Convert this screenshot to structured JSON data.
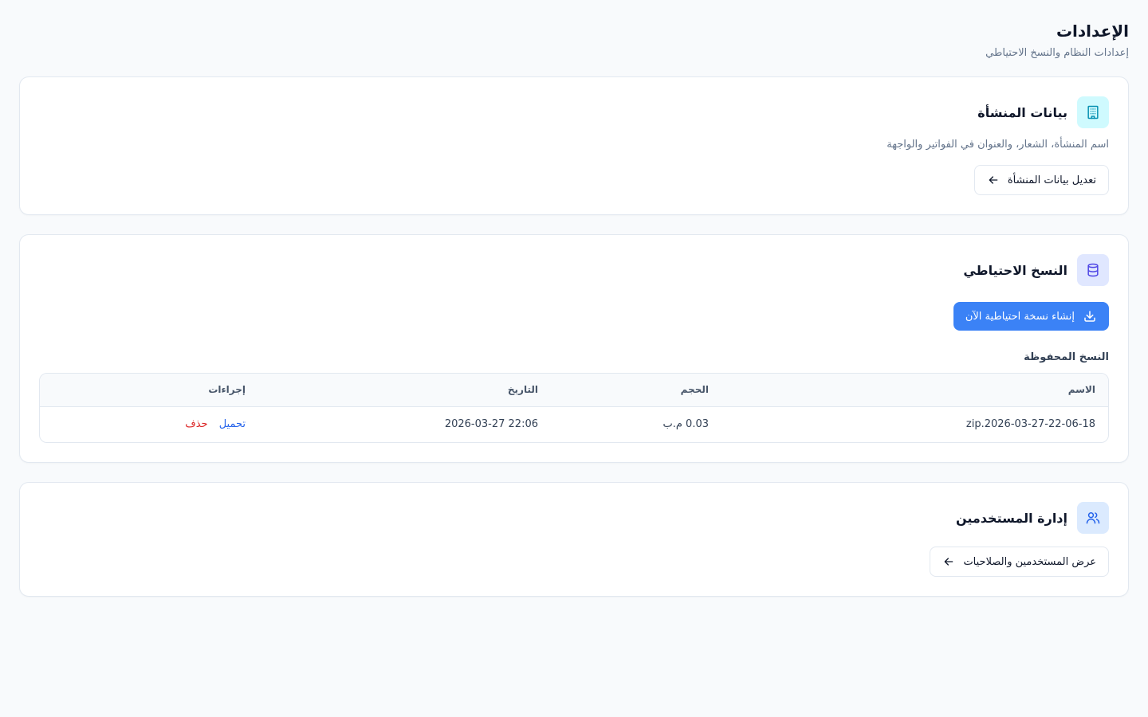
{
  "page": {
    "title": "الإعدادات",
    "subtitle": "إعدادات النظام والنسخ الاحتياطي"
  },
  "organization": {
    "title": "بيانات المنشأة",
    "description": "اسم المنشأة، الشعار، والعنوان في الفواتير والواجهة",
    "edit_button": "تعديل بيانات المنشأة",
    "icon": "building-icon",
    "icon_bg": "#cffafe",
    "icon_color": "#0891b2"
  },
  "backup": {
    "title": "النسخ الاحتياطي",
    "create_button": "إنشاء نسخة احتياطية الآن",
    "saved_label": "النسخ المحفوظة",
    "icon": "database-icon",
    "icon_bg": "#e0e7ff",
    "icon_color": "#4f46e5",
    "button_color": "#3b82f6",
    "table": {
      "columns": [
        "الاسم",
        "الحجم",
        "التاريخ",
        "إجراءات"
      ],
      "rows": [
        {
          "name": "zip.2026-03-27-22-06-18",
          "size": "0.03 م.ب",
          "date": "2026-03-27 22:06",
          "download": "تحميل",
          "delete": "حذف"
        }
      ]
    }
  },
  "users": {
    "title": "إدارة المستخدمين",
    "view_button": "عرض المستخدمين والصلاحيات",
    "icon": "users-icon",
    "icon_bg": "#dbeafe",
    "icon_color": "#2563eb"
  }
}
